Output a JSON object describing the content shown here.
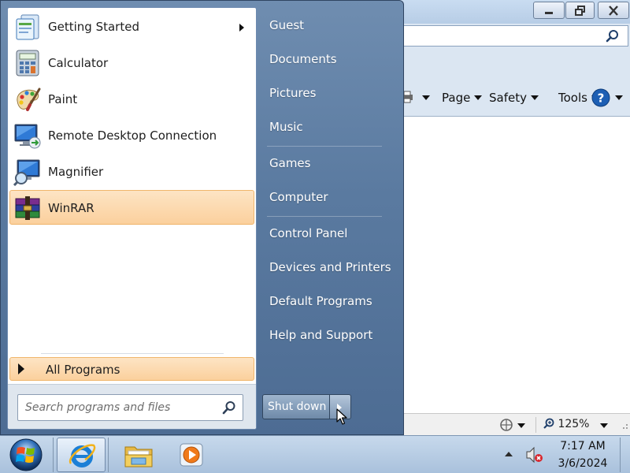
{
  "ie": {
    "command_bar": {
      "page": "Page",
      "safety": "Safety",
      "tools": "Tools"
    },
    "status": {
      "zoom": "125%"
    }
  },
  "start_menu": {
    "programs": [
      {
        "label": "Getting Started",
        "icon": "getting-started-icon",
        "has_submenu": true
      },
      {
        "label": "Calculator",
        "icon": "calculator-icon"
      },
      {
        "label": "Paint",
        "icon": "paint-icon"
      },
      {
        "label": "Remote Desktop Connection",
        "icon": "remote-desktop-icon"
      },
      {
        "label": "Magnifier",
        "icon": "magnifier-icon"
      },
      {
        "label": "WinRAR",
        "icon": "winrar-icon",
        "highlighted": true
      }
    ],
    "all_programs": "All Programs",
    "search": {
      "placeholder": "Search programs and files"
    },
    "places": [
      {
        "label": "Guest"
      },
      {
        "label": "Documents"
      },
      {
        "label": "Pictures"
      },
      {
        "label": "Music"
      },
      {
        "label": "Games"
      },
      {
        "label": "Computer"
      },
      {
        "label": "Control Panel"
      },
      {
        "label": "Devices and Printers"
      },
      {
        "label": "Default Programs"
      },
      {
        "label": "Help and Support"
      }
    ],
    "shutdown_label": "Shut down"
  },
  "taskbar": {
    "pinned": [
      "internet-explorer-icon",
      "windows-explorer-icon",
      "media-player-icon"
    ],
    "clock": {
      "time": "7:17 AM",
      "date": "3/6/2024"
    }
  },
  "colors": {
    "highlight": "#fbd09d",
    "start_menu_bg": "#5a7aa0",
    "taskbar_bg": "#b7cde6"
  }
}
